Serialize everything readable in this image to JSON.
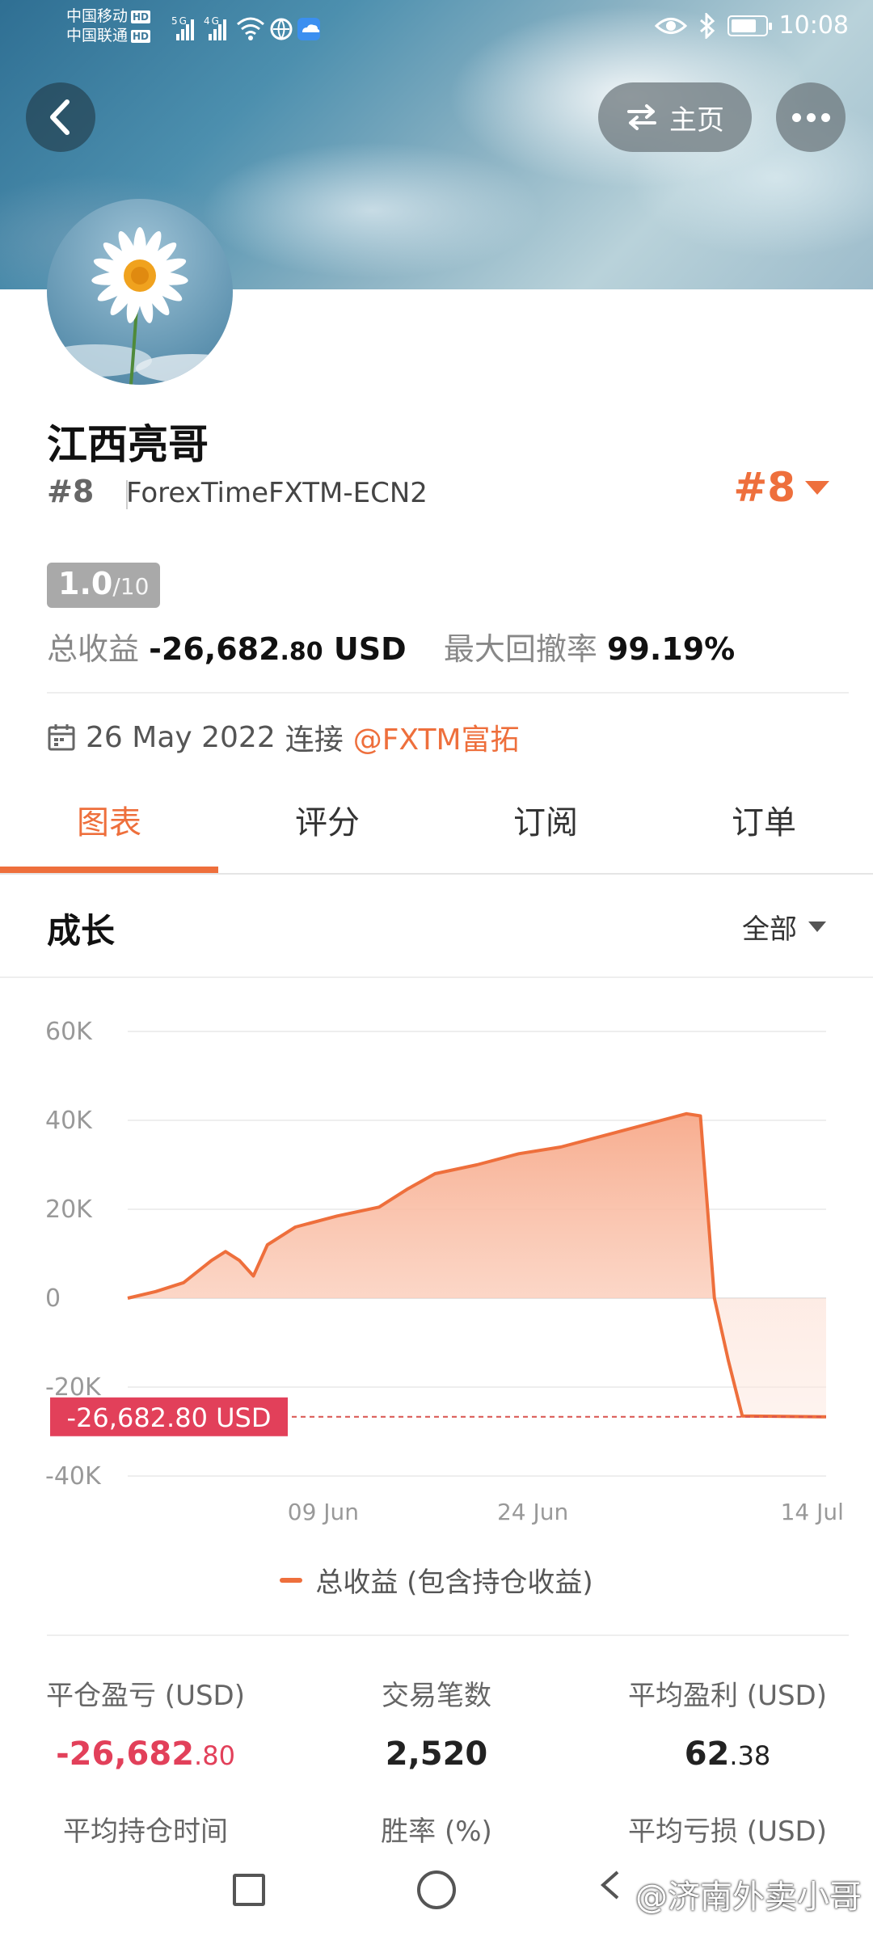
{
  "status_bar": {
    "carrier1": "中国移动",
    "carrier2": "中国联通",
    "hd": "HD",
    "net1": "5G",
    "net2": "4G",
    "time": "10:08"
  },
  "header": {
    "home_label": "主页"
  },
  "profile": {
    "name": "江西亮哥",
    "rank": "#8",
    "server": "ForexTimeFXTM-ECN2",
    "rank_right": "#8",
    "score_main": "1.0",
    "score_total": "/10",
    "total_profit_label": "总收益",
    "total_profit_value": "-26,682",
    "total_profit_decimal": ".80",
    "total_profit_currency": " USD",
    "drawdown_label": "最大回撤率",
    "drawdown_value": "99.19%",
    "joined_date": "26 May 2022",
    "joined_text": "连接",
    "broker_link": "@FXTM富拓"
  },
  "tabs": [
    {
      "label": "图表",
      "active": true
    },
    {
      "label": "评分",
      "active": false
    },
    {
      "label": "订阅",
      "active": false
    },
    {
      "label": "订单",
      "active": false
    }
  ],
  "growth": {
    "title": "成长",
    "range": "全部"
  },
  "chart_data": {
    "type": "area",
    "y_ticks": [
      "60K",
      "40K",
      "20K",
      "0",
      "-20K",
      "-40K"
    ],
    "ylim": [
      -40000,
      60000
    ],
    "x_ticks": [
      "09 Jun",
      "24 Jun",
      "14 Jul"
    ],
    "current_label": "-26,682.80 USD",
    "current_value": -26682.8,
    "color": "#ee6f3c",
    "series": [
      {
        "name": "总收益 (包含持仓收益)",
        "points": [
          {
            "x": "2022-05-26",
            "y": 0
          },
          {
            "x": "2022-05-28",
            "y": 1500
          },
          {
            "x": "2022-05-30",
            "y": 3500
          },
          {
            "x": "2022-06-01",
            "y": 8500
          },
          {
            "x": "2022-06-02",
            "y": 10500
          },
          {
            "x": "2022-06-03",
            "y": 8500
          },
          {
            "x": "2022-06-04",
            "y": 5000
          },
          {
            "x": "2022-06-05",
            "y": 12000
          },
          {
            "x": "2022-06-07",
            "y": 16000
          },
          {
            "x": "2022-06-10",
            "y": 18500
          },
          {
            "x": "2022-06-13",
            "y": 20500
          },
          {
            "x": "2022-06-15",
            "y": 24500
          },
          {
            "x": "2022-06-17",
            "y": 28000
          },
          {
            "x": "2022-06-20",
            "y": 30000
          },
          {
            "x": "2022-06-23",
            "y": 32500
          },
          {
            "x": "2022-06-26",
            "y": 34000
          },
          {
            "x": "2022-06-29",
            "y": 36500
          },
          {
            "x": "2022-07-02",
            "y": 39000
          },
          {
            "x": "2022-07-05",
            "y": 41500
          },
          {
            "x": "2022-07-06",
            "y": 41000
          },
          {
            "x": "2022-07-07",
            "y": 0
          },
          {
            "x": "2022-07-08",
            "y": -14000
          },
          {
            "x": "2022-07-09",
            "y": -26500
          },
          {
            "x": "2022-07-12",
            "y": -26600
          },
          {
            "x": "2022-07-15",
            "y": -26682.8
          }
        ]
      }
    ]
  },
  "legend": {
    "label": "总收益 (包含持仓收益)"
  },
  "stats": {
    "closed_pl_label": "平仓盈亏 (USD)",
    "closed_pl_value": "-26,682",
    "closed_pl_decimal": ".80",
    "trades_label": "交易笔数",
    "trades_value": "2,520",
    "avg_profit_label": "平均盈利 (USD)",
    "avg_profit_value": "62",
    "avg_profit_decimal": ".38",
    "avg_hold_label": "平均持仓时间",
    "win_rate_label": "胜率 (%)",
    "avg_loss_label": "平均亏损 (USD)"
  },
  "watermark": "@济南外卖小哥"
}
